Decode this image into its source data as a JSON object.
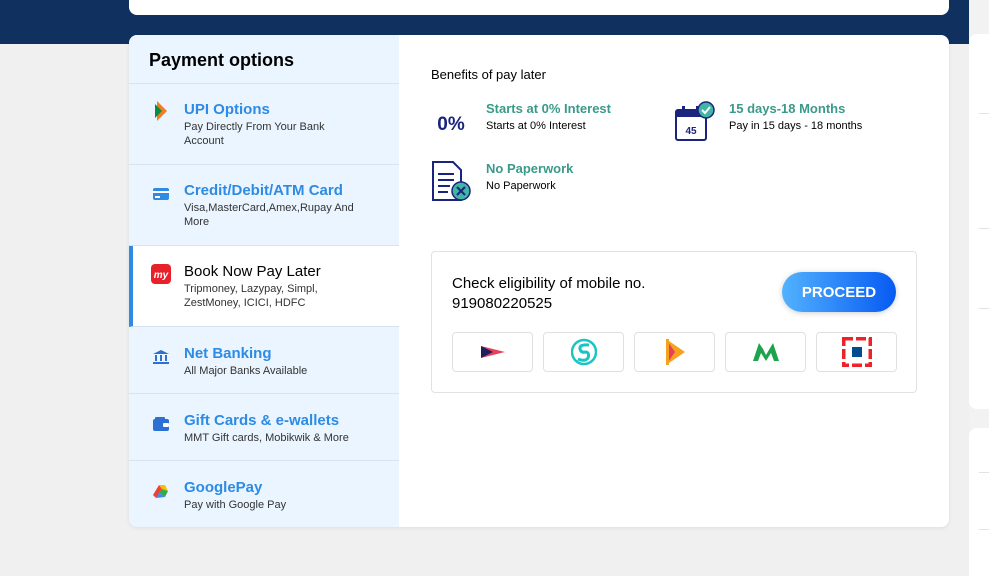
{
  "sidebar": {
    "title": "Payment options",
    "items": [
      {
        "label": "UPI Options",
        "sub": "Pay Directly From Your Bank Account",
        "icon": "upi-icon"
      },
      {
        "label": "Credit/Debit/ATM Card",
        "sub": "Visa,MasterCard,Amex,Rupay And More",
        "icon": "card-icon"
      },
      {
        "label": "Book Now Pay Later",
        "sub": "Tripmoney, Lazypay, Simpl, ZestMoney, ICICI, HDFC",
        "icon": "mmt-icon",
        "active": true
      },
      {
        "label": "Net Banking",
        "sub": "All Major Banks Available",
        "icon": "bank-icon"
      },
      {
        "label": "Gift Cards & e-wallets",
        "sub": "MMT Gift cards, Mobikwik & More",
        "icon": "wallet-icon"
      },
      {
        "label": "GooglePay",
        "sub": "Pay with Google Pay",
        "icon": "googlepay-icon"
      }
    ]
  },
  "benefits": {
    "title": "Benefits of pay later",
    "items": [
      {
        "head": "Starts at 0% Interest",
        "sub": "Starts at 0% Interest",
        "icon_text": "0%"
      },
      {
        "head": "15 days-18 Months",
        "sub": "Pay in 15 days - 18 months",
        "icon_text": "45"
      },
      {
        "head": "No Paperwork",
        "sub": "No Paperwork"
      }
    ]
  },
  "eligibility": {
    "line1": "Check eligibility of mobile no.",
    "mobile": "919080220525",
    "button": "PROCEED",
    "partners": [
      "tripmoney-logo",
      "simpl-logo",
      "lazypay-logo",
      "zestmoney-logo",
      "hdfc-logo"
    ]
  },
  "colors": {
    "accent": "#2d8be4",
    "benefit_head": "#3a9a8a",
    "header_band": "#10305f",
    "sidebar_bg": "#eaf5ff"
  }
}
